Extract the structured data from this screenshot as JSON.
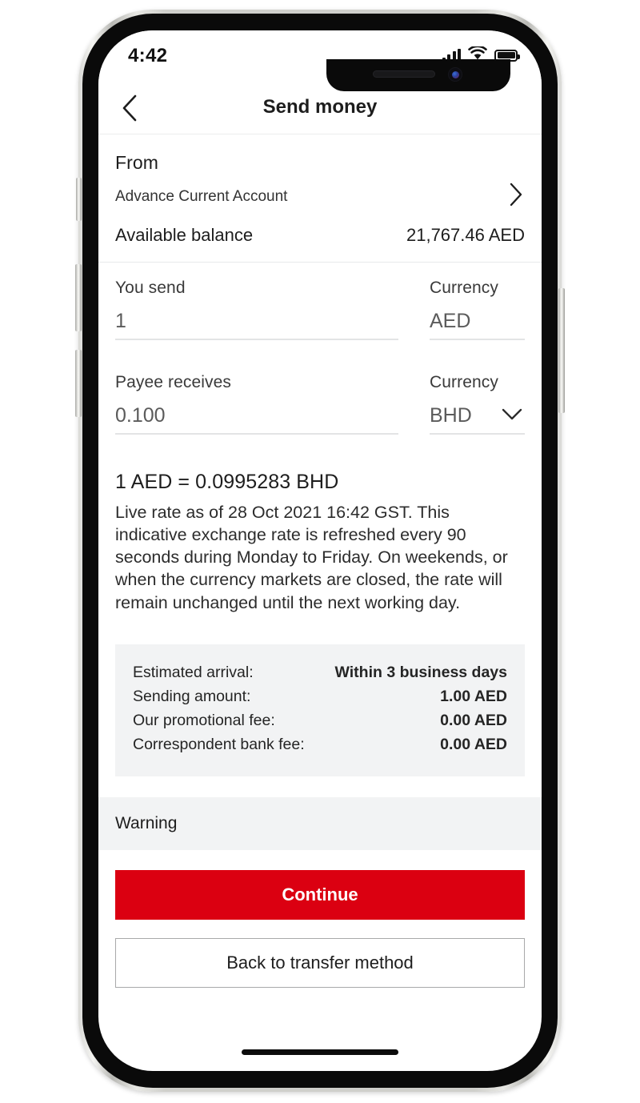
{
  "status_bar": {
    "time": "4:42",
    "signal_icon": "cellular-signal-icon",
    "wifi_icon": "wifi-icon",
    "battery_icon": "battery-full-icon"
  },
  "header": {
    "back_icon": "chevron-left-icon",
    "title": "Send money"
  },
  "from_section": {
    "label": "From",
    "account_name": "Advance Current Account",
    "disclose_icon": "chevron-right-icon",
    "balance_label": "Available balance",
    "balance_value": "21,767.46 AED"
  },
  "send_field": {
    "label": "You send",
    "value": "1",
    "currency_label": "Currency",
    "currency_value": "AED"
  },
  "receive_field": {
    "label": "Payee receives",
    "value": "0.100",
    "currency_label": "Currency",
    "currency_value": "BHD",
    "dropdown_icon": "chevron-down-icon"
  },
  "rate": {
    "line": "1 AED = 0.0995283 BHD",
    "note": "Live rate as of 28 Oct 2021 16:42 GST. This indicative exchange rate is refreshed every 90 seconds during Monday to Friday. On weekends, or when the currency markets are closed, the rate will remain unchanged until the next working day."
  },
  "summary": {
    "rows": [
      {
        "label": "Estimated arrival:",
        "value": "Within 3 business days"
      },
      {
        "label": "Sending amount:",
        "value": "1.00 AED"
      },
      {
        "label": "Our promotional fee:",
        "value": "0.00 AED"
      },
      {
        "label": "Correspondent bank fee:",
        "value": "0.00 AED"
      }
    ]
  },
  "warning": {
    "title": "Warning"
  },
  "actions": {
    "primary_label": "Continue",
    "secondary_label": "Back to transfer method"
  },
  "colors": {
    "brand_red": "#db0011",
    "panel_gray": "#f2f3f4",
    "text_dark": "#1d1d1d"
  }
}
